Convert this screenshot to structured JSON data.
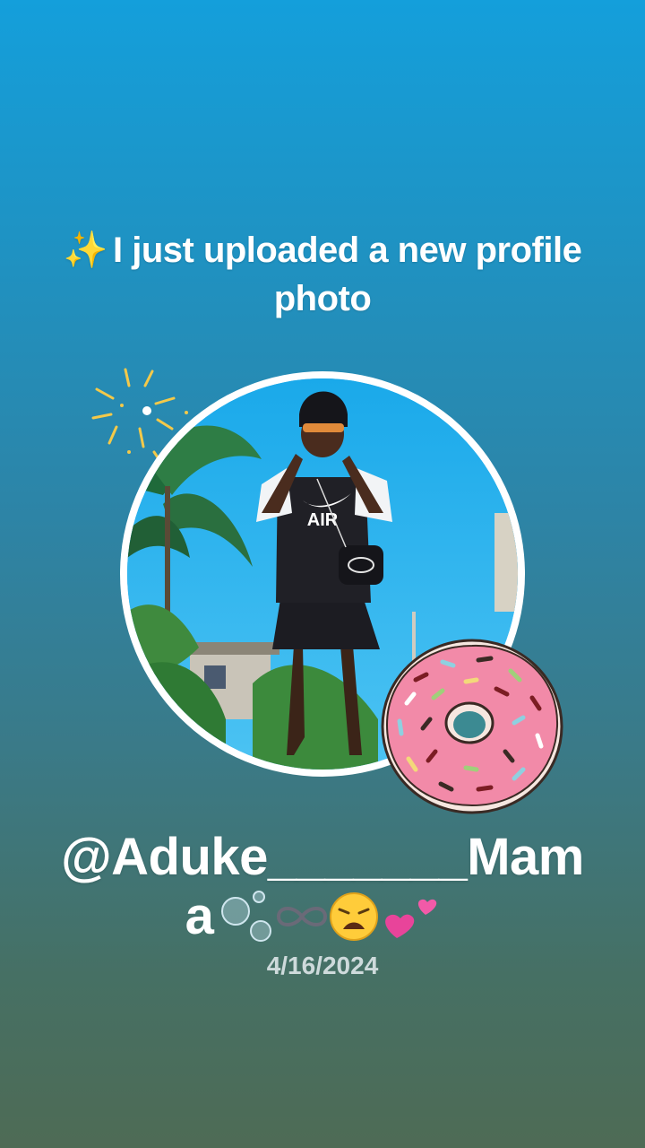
{
  "headline": {
    "icon": "sparkles-icon",
    "icon_glyph": "✨",
    "text": "I just uploaded a new profile photo"
  },
  "profile": {
    "username_line1": "@Aduke_______Mam",
    "username_line2_text": "a",
    "username_emoji": [
      "bubbles-emoji",
      "infinity-emoji",
      "weary-face-emoji",
      "two-hearts-emoji"
    ],
    "date": "4/16/2024"
  },
  "stickers": [
    "sparkle-burst-sticker",
    "sprinkle-donut-sticker"
  ],
  "colors": {
    "background_top": "#149fdb",
    "background_bottom": "#4e6b55",
    "text": "#ffffff",
    "sparkle": "#ffd54a",
    "donut_frosting": "#f28aa8"
  }
}
